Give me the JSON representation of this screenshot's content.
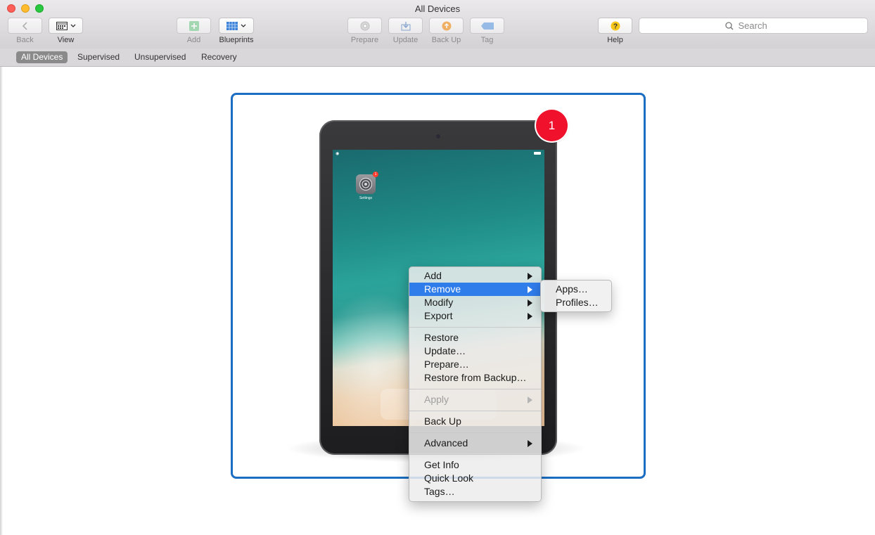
{
  "window": {
    "title": "All Devices"
  },
  "toolbar": {
    "back_label": "Back",
    "view_label": "View",
    "add_label": "Add",
    "blueprints_label": "Blueprints",
    "prepare_label": "Prepare",
    "update_label": "Update",
    "backup_label": "Back Up",
    "tag_label": "Tag",
    "help_label": "Help",
    "search_placeholder": "Search"
  },
  "scopes": [
    "All Devices",
    "Supervised",
    "Unsupervised",
    "Recovery"
  ],
  "device": {
    "badge_count": "1",
    "home_app": {
      "name": "Settings",
      "badge": "1"
    }
  },
  "context_menu": {
    "items": [
      {
        "label": "Add",
        "submenu": true
      },
      {
        "label": "Remove",
        "submenu": true,
        "highlighted": true
      },
      {
        "label": "Modify",
        "submenu": true
      },
      {
        "label": "Export",
        "submenu": true
      },
      {
        "label": "Restore"
      },
      {
        "label": "Update…"
      },
      {
        "label": "Prepare…"
      },
      {
        "label": "Restore from Backup…"
      },
      {
        "label": "Apply",
        "submenu": true,
        "disabled": true
      },
      {
        "label": "Back Up"
      },
      {
        "label": "Advanced",
        "submenu": true
      },
      {
        "label": "Get Info"
      },
      {
        "label": "Quick Look"
      },
      {
        "label": "Tags…"
      }
    ],
    "remove_submenu": [
      "Apps…",
      "Profiles…"
    ]
  },
  "colors": {
    "selection_border": "#1b6ec2",
    "menu_highlight": "#2f7ceb",
    "device_badge": "#f0122c",
    "close_button": "#fc5f57",
    "minimize_button": "#fdbc2e",
    "zoom_button": "#28c840"
  }
}
